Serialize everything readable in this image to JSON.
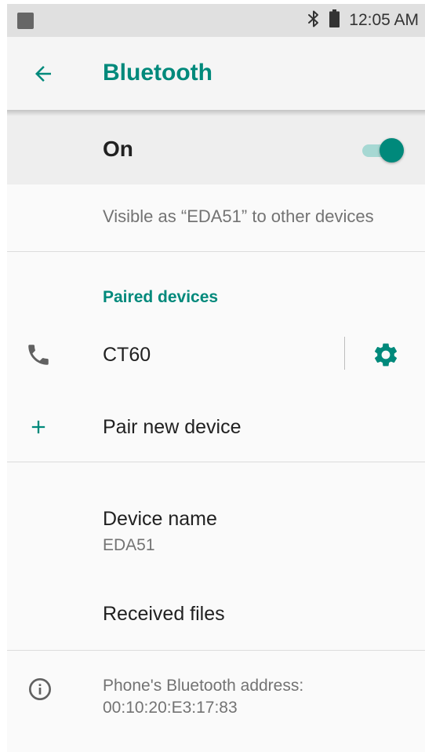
{
  "status_bar": {
    "time": "12:05 AM",
    "icons": [
      "notification-icon",
      "bluetooth-icon",
      "battery-icon"
    ]
  },
  "toolbar": {
    "title": "Bluetooth",
    "back_icon": "arrow-back-icon"
  },
  "master_switch": {
    "label": "On",
    "checked": true
  },
  "visible_text": "Visible as “EDA51” to other devices",
  "paired_devices": {
    "header": "Paired devices",
    "items": [
      {
        "name": "CT60",
        "icon": "phone-icon",
        "settings_icon": "gear-icon"
      }
    ]
  },
  "pair_new": {
    "label": "Pair new device",
    "icon": "plus-icon"
  },
  "device_name": {
    "title": "Device name",
    "value": "EDA51"
  },
  "received_files": {
    "label": "Received files"
  },
  "bt_address": {
    "label": "Phone's Bluetooth address:",
    "value": "00:10:20:E3:17:83",
    "icon": "info-icon"
  },
  "colors": {
    "accent": "#00897b",
    "accent_light": "#a6d8d3",
    "text_primary": "#212121",
    "text_secondary": "#737373",
    "status_bar_bg": "#e0e0e0",
    "switch_bar_bg": "#eeeeee",
    "background": "#fafafa"
  }
}
